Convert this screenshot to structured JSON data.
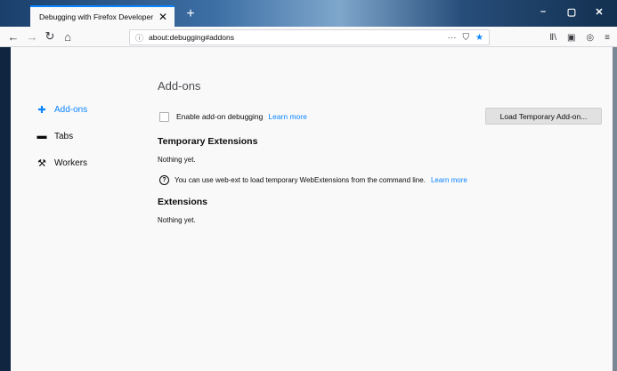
{
  "tab": {
    "title": "Debugging with Firefox Developer",
    "close": "✕",
    "new_tab": "+"
  },
  "window_controls": {
    "minimize": "–",
    "maximize": "▢",
    "close": "✕"
  },
  "nav": {
    "back": "←",
    "forward": "→",
    "reload": "↻",
    "home": "⌂",
    "url_info": "ⓘ",
    "url": "about:debugging#addons",
    "page_actions": "···",
    "pocket": "⛉",
    "bookmark": "★",
    "library": "Ⅱ\\",
    "sidebar": "▣",
    "extension": "◎",
    "menu": "≡"
  },
  "sidebar": {
    "items": [
      {
        "label": "Add-ons",
        "icon": "puzzle-icon",
        "glyph": "✚",
        "active": true
      },
      {
        "label": "Tabs",
        "icon": "tab-icon",
        "glyph": "▬",
        "active": false
      },
      {
        "label": "Workers",
        "icon": "tools-icon",
        "glyph": "⚒",
        "active": false
      }
    ]
  },
  "main": {
    "title": "Add-ons",
    "debug_checkbox_label": "Enable add-on debugging",
    "learn_more_1": "Learn more",
    "load_button": "Load Temporary Add-on...",
    "temp_heading": "Temporary Extensions",
    "temp_empty": "Nothing yet.",
    "tip_icon": "?",
    "tip_text": "You can use web-ext to load temporary WebExtensions from the command line.",
    "learn_more_2": "Learn more",
    "ext_heading": "Extensions",
    "ext_empty": "Nothing yet."
  },
  "colors": {
    "accent": "#0a84ff",
    "page_bg": "#f9f9fa"
  }
}
